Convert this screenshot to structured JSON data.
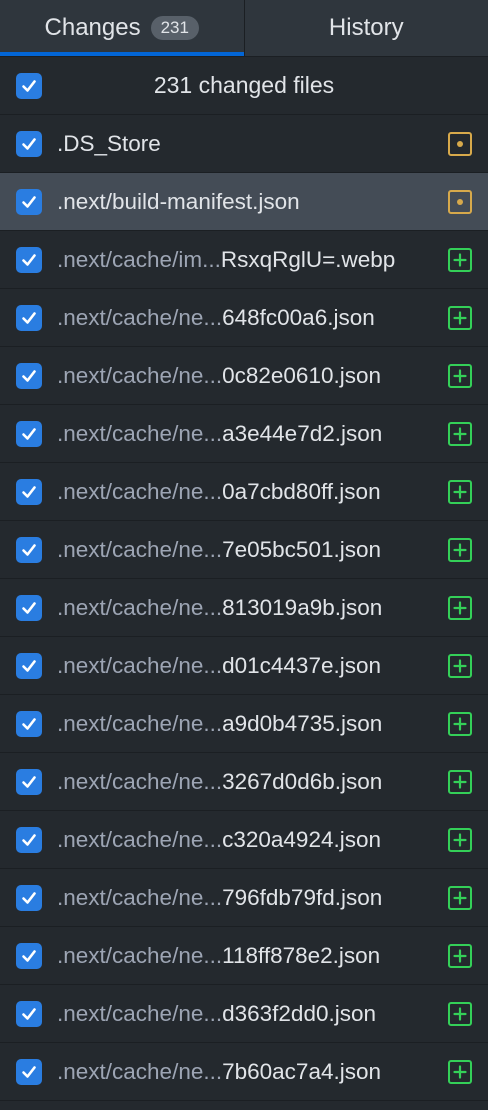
{
  "tabs": {
    "changes_label": "Changes",
    "changes_count": "231",
    "history_label": "History"
  },
  "header": {
    "label": "231 changed files"
  },
  "files": [
    {
      "dim": "",
      "bright": ".DS_Store",
      "status": "modified",
      "selected": false
    },
    {
      "dim": "",
      "bright": ".next/build-manifest.json",
      "status": "modified",
      "selected": true
    },
    {
      "dim": ".next/cache/im...",
      "bright": "RsxqRglU=.webp",
      "status": "added",
      "selected": false
    },
    {
      "dim": ".next/cache/ne...",
      "bright": "648fc00a6.json",
      "status": "added",
      "selected": false
    },
    {
      "dim": ".next/cache/ne...",
      "bright": "0c82e0610.json",
      "status": "added",
      "selected": false
    },
    {
      "dim": ".next/cache/ne...",
      "bright": "a3e44e7d2.json",
      "status": "added",
      "selected": false
    },
    {
      "dim": ".next/cache/ne...",
      "bright": "0a7cbd80ff.json",
      "status": "added",
      "selected": false
    },
    {
      "dim": ".next/cache/ne...",
      "bright": "7e05bc501.json",
      "status": "added",
      "selected": false
    },
    {
      "dim": ".next/cache/ne...",
      "bright": "813019a9b.json",
      "status": "added",
      "selected": false
    },
    {
      "dim": ".next/cache/ne...",
      "bright": "d01c4437e.json",
      "status": "added",
      "selected": false
    },
    {
      "dim": ".next/cache/ne...",
      "bright": "a9d0b4735.json",
      "status": "added",
      "selected": false
    },
    {
      "dim": ".next/cache/ne...",
      "bright": "3267d0d6b.json",
      "status": "added",
      "selected": false
    },
    {
      "dim": ".next/cache/ne...",
      "bright": "c320a4924.json",
      "status": "added",
      "selected": false
    },
    {
      "dim": ".next/cache/ne...",
      "bright": "796fdb79fd.json",
      "status": "added",
      "selected": false
    },
    {
      "dim": ".next/cache/ne...",
      "bright": "118ff878e2.json",
      "status": "added",
      "selected": false
    },
    {
      "dim": ".next/cache/ne...",
      "bright": "d363f2dd0.json",
      "status": "added",
      "selected": false
    },
    {
      "dim": ".next/cache/ne...",
      "bright": "7b60ac7a4.json",
      "status": "added",
      "selected": false
    }
  ],
  "colors": {
    "background": "#24292e",
    "selected_row": "#444c56",
    "checkbox": "#2a7de1",
    "modified": "#d7a94b",
    "added": "#34d058",
    "tab_underline": "#0366d6"
  },
  "icons": {
    "checkbox": "check-icon",
    "modified": "file-modified-icon",
    "added": "file-added-icon"
  }
}
